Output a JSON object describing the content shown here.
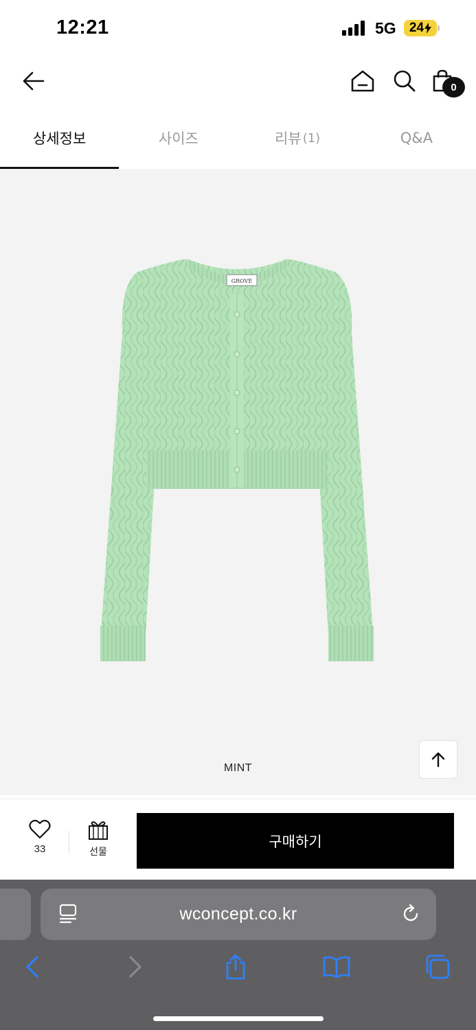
{
  "status": {
    "time": "12:21",
    "network": "5G",
    "battery": "24"
  },
  "header": {
    "cart_count": "0"
  },
  "tabs": [
    {
      "label": "상세정보",
      "count": "",
      "active": true
    },
    {
      "label": "사이즈",
      "count": "",
      "active": false
    },
    {
      "label": "리뷰",
      "count": "(1)",
      "active": false
    },
    {
      "label": "Q&A",
      "count": "",
      "active": false
    }
  ],
  "product": {
    "color_name": "MINT",
    "brand_tag": "GROVE",
    "swatch_color": "#b5e3b9"
  },
  "actions": {
    "like_count": "33",
    "gift_label": "선물",
    "buy_label": "구매하기"
  },
  "browser": {
    "url": "wconcept.co.kr"
  },
  "colors": {
    "accent": "#000000",
    "safari_blue": "#2f7ff5",
    "sweater": "#b5e3b9"
  }
}
